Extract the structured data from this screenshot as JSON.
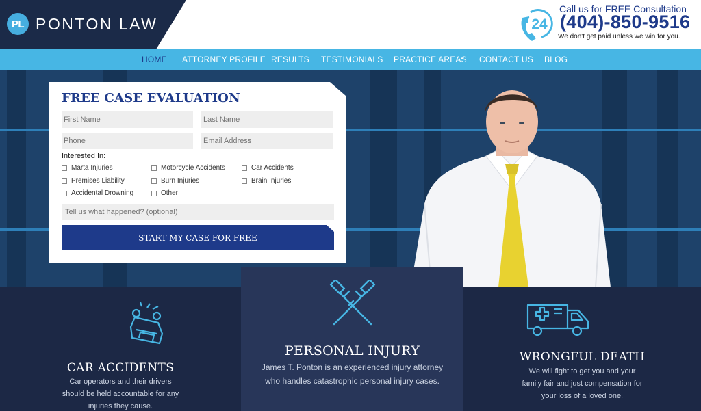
{
  "header": {
    "logo_initials": "PL",
    "logo_text": "PONTON LAW",
    "phone_icon_label": "24",
    "call_text": "Call us for FREE Consultation",
    "phone_number": "(404)-850-9516",
    "tagline": "We don't get paid unless we win for you."
  },
  "nav": {
    "items": [
      {
        "label": "HOME"
      },
      {
        "label": "ATTORNEY PROFILE"
      },
      {
        "label": "RESULTS"
      },
      {
        "label": "TESTIMONIALS"
      },
      {
        "label": "PRACTICE AREAS"
      },
      {
        "label": "CONTACT US"
      },
      {
        "label": "BLOG"
      }
    ],
    "dropdown_glyph": "⌄"
  },
  "form": {
    "title": "FREE CASE EVALUATION",
    "first_name_placeholder": "First Name",
    "last_name_placeholder": "Last Name",
    "phone_placeholder": "Phone",
    "email_placeholder": "Email Address",
    "interested_label": "Interested In:",
    "options": [
      "Marta Injuries",
      "Motorcycle Accidents",
      "Car Accidents",
      "Premises Liability",
      "Burn Injuries",
      "Brain Injuries",
      "Accidental Drowning",
      "Other"
    ],
    "message_placeholder": "Tell us what happened? (optional)",
    "submit_label": "START MY CASE FOR FREE"
  },
  "cards": [
    {
      "title": "CAR ACCIDENTS",
      "text": "Car operators and their drivers should be held accountable for any injuries they cause.",
      "icon": "overturned-car-icon"
    },
    {
      "title": "PERSONAL INJURY",
      "text": "James T. Ponton is an experienced injury attorney who handles catastrophic personal injury cases.",
      "icon": "crutches-icon"
    },
    {
      "title": "WRONGFUL DEATH",
      "text": "We will fight to get you and your family fair and just compensation for your loss of a loved one.",
      "icon": "ambulance-icon"
    }
  ],
  "colors": {
    "navy": "#1b2a48",
    "accent_blue": "#47b6e4",
    "brand_blue": "#1e3a8a",
    "icon_blue": "#47b6e4"
  }
}
